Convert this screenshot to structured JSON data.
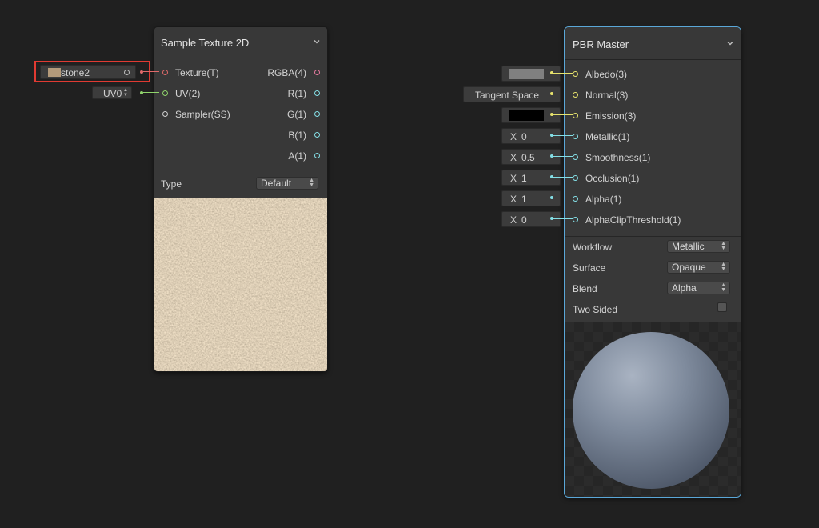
{
  "sample_node": {
    "title": "Sample Texture 2D",
    "inputs": [
      {
        "label": "Texture(T)"
      },
      {
        "label": "UV(2)"
      },
      {
        "label": "Sampler(SS)"
      }
    ],
    "outputs": [
      {
        "label": "RGBA(4)"
      },
      {
        "label": "R(1)"
      },
      {
        "label": "G(1)"
      },
      {
        "label": "B(1)"
      },
      {
        "label": "A(1)"
      }
    ],
    "type_label": "Type",
    "type_value": "Default"
  },
  "texture_field": {
    "name": "stone2",
    "highlighted": true,
    "swatch_color": "#b49a7a"
  },
  "uv_field": {
    "value": "UV0"
  },
  "pbr_node": {
    "title": "PBR Master",
    "inputs": [
      {
        "label": "Albedo(3)",
        "field_kind": "color",
        "color": "#808080"
      },
      {
        "label": "Normal(3)",
        "field_kind": "text",
        "value": "Tangent Space"
      },
      {
        "label": "Emission(3)",
        "field_kind": "color",
        "color": "#000000"
      },
      {
        "label": "Metallic(1)",
        "field_kind": "number",
        "axis": "X",
        "value": "0"
      },
      {
        "label": "Smoothness(1)",
        "field_kind": "number",
        "axis": "X",
        "value": "0.5"
      },
      {
        "label": "Occlusion(1)",
        "field_kind": "number",
        "axis": "X",
        "value": "1"
      },
      {
        "label": "Alpha(1)",
        "field_kind": "number",
        "axis": "X",
        "value": "1"
      },
      {
        "label": "AlphaClipThreshold(1)",
        "field_kind": "number",
        "axis": "X",
        "value": "0"
      }
    ],
    "settings": [
      {
        "label": "Workflow",
        "value": "Metallic"
      },
      {
        "label": "Surface",
        "value": "Opaque"
      },
      {
        "label": "Blend",
        "value": "Alpha"
      }
    ],
    "two_sided_label": "Two Sided",
    "two_sided_checked": false
  },
  "colors": {
    "background": "#202020",
    "node_body": "#383838",
    "selection_outline": "#5aa7d8",
    "highlight_box": "#e03a32"
  }
}
